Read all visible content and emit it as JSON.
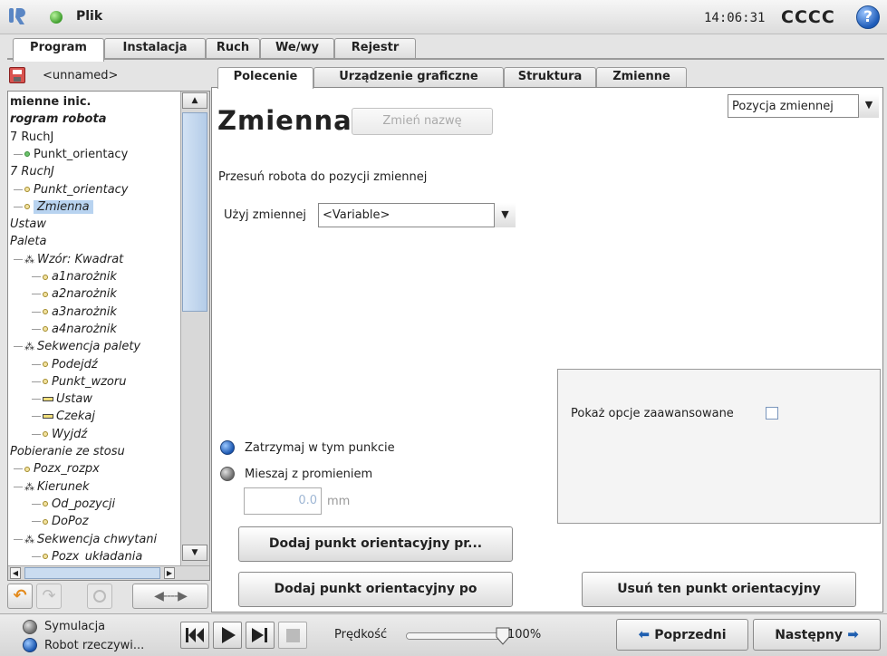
{
  "app": {
    "menu_label": "Plik",
    "time": "14:06:31",
    "robot_name": "CCCC",
    "help_icon": "help-icon"
  },
  "main_tabs": [
    "Program",
    "Instalacja",
    "Ruch",
    "We/wy",
    "Rejestr"
  ],
  "file": {
    "name": "<unnamed>"
  },
  "tree": [
    {
      "label": "mienne inic.",
      "style": "bold",
      "indent": 0,
      "icon": "none"
    },
    {
      "label": "rogram robota",
      "style": "bold-italic",
      "indent": 0,
      "icon": "none"
    },
    {
      "label": "7 RuchJ",
      "style": "normal",
      "indent": 0,
      "icon": "none"
    },
    {
      "label": "Punkt_orientacy",
      "style": "normal",
      "indent": 1,
      "icon": "waypoint-green"
    },
    {
      "label": "7 RuchJ",
      "style": "italic",
      "indent": 0,
      "icon": "none"
    },
    {
      "label": "Punkt_orientacy",
      "style": "italic",
      "indent": 1,
      "icon": "waypoint"
    },
    {
      "label": "Zmienna",
      "style": "italic-selected",
      "indent": 1,
      "icon": "waypoint"
    },
    {
      "label": "Ustaw",
      "style": "italic",
      "indent": 0,
      "icon": "none"
    },
    {
      "label": "Paleta",
      "style": "italic",
      "indent": 0,
      "icon": "none"
    },
    {
      "label": "Wzór: Kwadrat",
      "style": "italic",
      "indent": 1,
      "icon": "pattern"
    },
    {
      "label": "a1narożnik",
      "style": "italic",
      "indent": 2,
      "icon": "waypoint"
    },
    {
      "label": "a2narożnik",
      "style": "italic",
      "indent": 2,
      "icon": "waypoint"
    },
    {
      "label": "a3narożnik",
      "style": "italic",
      "indent": 2,
      "icon": "waypoint"
    },
    {
      "label": "a4narożnik",
      "style": "italic",
      "indent": 2,
      "icon": "waypoint"
    },
    {
      "label": "Sekwencja palety",
      "style": "italic",
      "indent": 1,
      "icon": "pattern"
    },
    {
      "label": "Podejdź",
      "style": "italic",
      "indent": 2,
      "icon": "waypoint"
    },
    {
      "label": "Punkt_wzoru",
      "style": "italic",
      "indent": 2,
      "icon": "waypoint"
    },
    {
      "label": "Ustaw",
      "style": "italic",
      "indent": 2,
      "icon": "set"
    },
    {
      "label": "Czekaj",
      "style": "italic",
      "indent": 2,
      "icon": "set"
    },
    {
      "label": "Wyjdź",
      "style": "italic",
      "indent": 2,
      "icon": "waypoint"
    },
    {
      "label": "Pobieranie ze stosu",
      "style": "italic",
      "indent": 0,
      "icon": "none"
    },
    {
      "label": "Pozx_rozpx",
      "style": "italic",
      "indent": 1,
      "icon": "waypoint"
    },
    {
      "label": "Kierunek",
      "style": "italic",
      "indent": 1,
      "icon": "pattern"
    },
    {
      "label": "Od_pozycji",
      "style": "italic",
      "indent": 2,
      "icon": "waypoint"
    },
    {
      "label": "DoPoz",
      "style": "italic",
      "indent": 2,
      "icon": "waypoint"
    },
    {
      "label": "Sekwencja chwytani",
      "style": "italic",
      "indent": 1,
      "icon": "pattern"
    },
    {
      "label": "Pozx_układania",
      "style": "italic",
      "indent": 2,
      "icon": "waypoint"
    }
  ],
  "sub_tabs": [
    "Polecenie",
    "Urządzenie graficzne",
    "Struktura",
    "Zmienne"
  ],
  "command": {
    "title": "Zmienna",
    "rename_button": "Zmień nazwę",
    "position_type": "Pozycja zmiennej",
    "description": "Przesuń robota do pozycji zmiennej",
    "use_variable_label": "Użyj zmiennej",
    "variable_value": "<Variable>",
    "stop_label": "Zatrzymaj w tym punkcie",
    "blend_label": "Mieszaj z promieniem",
    "radius_value": "0.0",
    "radius_unit": "mm",
    "advanced_label": "Pokaż opcje zaawansowane",
    "add_before_button": "Dodaj punkt orientacyjny pr...",
    "add_after_button": "Dodaj punkt orientacyjny po",
    "remove_button": "Usuń ten punkt orientacyjny"
  },
  "footer": {
    "simulation_label": "Symulacja",
    "real_robot_label": "Robot rzeczywi...",
    "speed_label": "Prędkość",
    "speed_value": "100%",
    "speed_fraction": 1.0,
    "prev_button": "Poprzedni",
    "next_button": "Następny"
  },
  "colors": {
    "accent_blue": "#1f5fb0",
    "tab_bg": "#ffffff",
    "selected": "#b8d3f0"
  }
}
